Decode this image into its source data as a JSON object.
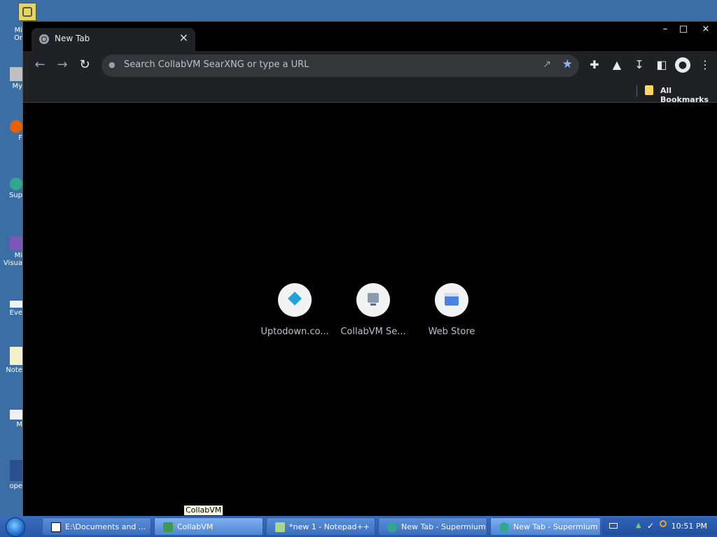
{
  "desktop": {
    "icons": [
      {
        "label": "Mi",
        "label2": "Or",
        "icon": "onenote-icon"
      },
      {
        "label": "My",
        "icon": "my-computer-icon"
      },
      {
        "label": "F",
        "icon": "firefox-icon"
      },
      {
        "label": "Sup",
        "icon": "supermium-icon"
      },
      {
        "label": "Mi",
        "label2": "Visua",
        "icon": "visual-studio-icon"
      },
      {
        "label": "Eve",
        "icon": "everything-icon"
      },
      {
        "label": "Note",
        "icon": "notepad-icon"
      },
      {
        "label": "M",
        "icon": "shortcut-icon"
      },
      {
        "label": "ope",
        "icon": "openoffice-icon"
      }
    ]
  },
  "browser": {
    "tab": {
      "title": "New Tab",
      "close_label": "×"
    },
    "window_controls": {
      "minimize": "–",
      "maximize": "□",
      "close": "×"
    },
    "toolbar": {
      "back": "←",
      "forward": "→",
      "reload": "↻",
      "omnibox_placeholder": "Search CollabVM SearXNG or type a URL"
    },
    "bookmarks_bar": {
      "all_bookmarks": "All Bookmarks"
    },
    "shortcuts": [
      {
        "label": "Uptodown.co...",
        "icon": "uptodown-icon"
      },
      {
        "label": "CollabVM Se...",
        "icon": "collabvm-icon"
      },
      {
        "label": "Web Store",
        "icon": "web-store-icon"
      }
    ]
  },
  "tooltip": {
    "text": "CollabVM"
  },
  "taskbar": {
    "items": [
      {
        "label": "E:\\Documents and ...",
        "icon": "7zip-icon",
        "active": false
      },
      {
        "label": "CollabVM",
        "icon": "collabvm-icon",
        "active": true
      },
      {
        "label": "*new 1 - Notepad++",
        "icon": "notepadpp-icon",
        "active": false
      },
      {
        "label": "New Tab - Supermium",
        "icon": "supermium-icon",
        "active": false
      },
      {
        "label": "New Tab - Supermium",
        "icon": "supermium-icon",
        "active": false
      }
    ],
    "tray": {
      "clock": "10:51 PM"
    }
  },
  "colors": {
    "desktop_bg": "#3a6ea5",
    "browser_toolbar": "#202124",
    "omnibox_bg": "#35363a",
    "star_accent": "#8ab4f8"
  }
}
